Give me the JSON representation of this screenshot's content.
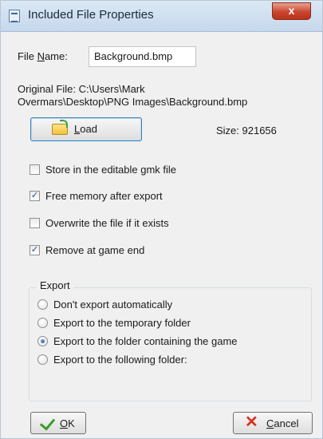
{
  "window": {
    "title": "Included File Properties",
    "close_glyph": "x"
  },
  "file_name": {
    "label_prefix": "File ",
    "label_underline": "N",
    "label_suffix": "ame:",
    "value": "Background.bmp"
  },
  "original_file": {
    "line1": "Original File: C:\\Users\\Mark",
    "line2": "Overmars\\Desktop\\PNG  Images\\Background.bmp"
  },
  "load_button": {
    "underline": "L",
    "suffix": "oad",
    "icon": "folder-open-icon"
  },
  "size_text": "Size: 921656",
  "checkboxes": [
    {
      "label": "Store in the editable gmk file",
      "checked": false,
      "glyph": ""
    },
    {
      "label": "Free memory after export",
      "checked": true,
      "glyph": "✓"
    },
    {
      "label": "Overwrite the file if it exists",
      "checked": false,
      "glyph": ""
    },
    {
      "label": "Remove at game end",
      "checked": true,
      "glyph": "✓"
    }
  ],
  "export_group": {
    "title": "Export",
    "options": [
      {
        "label": "Don't export automatically",
        "selected": false
      },
      {
        "label": "Export to the temporary folder",
        "selected": false
      },
      {
        "label": "Export to the folder containing the game",
        "selected": true
      },
      {
        "label": "Export to the following folder:",
        "selected": false
      }
    ]
  },
  "buttons": {
    "ok": {
      "underline": "O",
      "suffix": "K",
      "icon": "checkmark-icon",
      "icon_color": "#3b9a28"
    },
    "cancel": {
      "underline": "C",
      "suffix": "ancel",
      "icon": "red-x-icon",
      "icon_color": "#d8301d",
      "glyph": "✕"
    }
  }
}
